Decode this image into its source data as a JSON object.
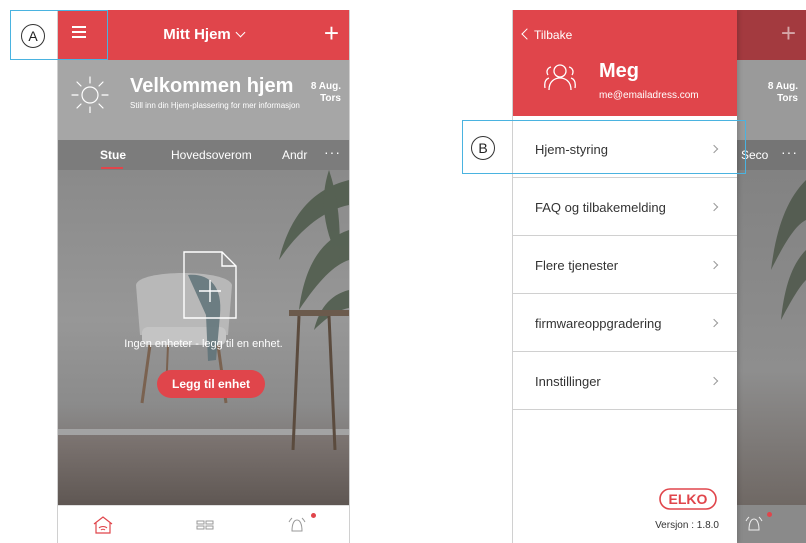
{
  "annotations": {
    "a": "A",
    "b": "B"
  },
  "home": {
    "title": "Mitt Hjem",
    "add_symbol": "+",
    "welcome_title": "Velkommen hjem",
    "welcome_subtitle": "Still inn din Hjem-plassering for mer informasjon",
    "date_day": "8 Aug.",
    "date_weekday": "Tors",
    "tabs": [
      "Stue",
      "Hovedsoverom",
      "Andr"
    ],
    "more_symbol": "···",
    "empty_message": "Ingen enheter - legg til en enhet.",
    "add_button": "Legg til enhet"
  },
  "background_home": {
    "add_symbol": "+",
    "date_day": "8 Aug.",
    "date_weekday": "Tors",
    "tab_fragment": "Seco",
    "more_symbol": "···"
  },
  "drawer": {
    "back_label": "Tilbake",
    "user_name": "Meg",
    "user_email": "me@emailadress.com",
    "menu": [
      "Hjem-styring",
      "FAQ og tilbakemelding",
      "Flere tjenester",
      "firmwareoppgradering",
      "Innstillinger"
    ],
    "logo_text": "ELKO",
    "version": "Versjon : 1.8.0"
  },
  "colors": {
    "accent": "#e0454b",
    "highlight": "#4ab3e0"
  }
}
